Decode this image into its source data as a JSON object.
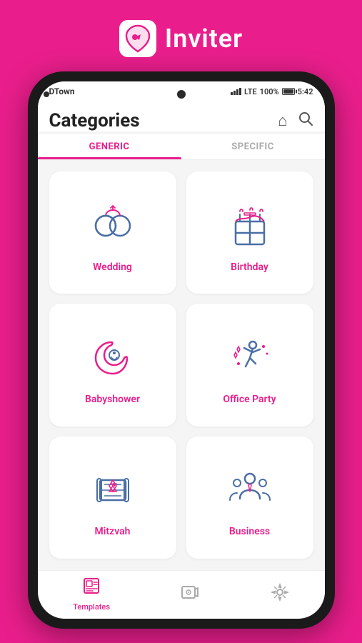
{
  "app": {
    "title": "Inviter",
    "logo_alt": "Inviter logo"
  },
  "status_bar": {
    "carrier": "DTown",
    "lte": "LTE",
    "battery": "100%",
    "time": "5:42"
  },
  "page": {
    "title": "Categories",
    "home_icon": "🏠",
    "search_icon": "🔍"
  },
  "tabs": [
    {
      "id": "generic",
      "label": "GENERIC",
      "active": true
    },
    {
      "id": "specific",
      "label": "SPECIFIC",
      "active": false
    }
  ],
  "categories": [
    {
      "id": "wedding",
      "label": "Wedding"
    },
    {
      "id": "birthday",
      "label": "Birthday"
    },
    {
      "id": "babyshower",
      "label": "Babyshower"
    },
    {
      "id": "office-party",
      "label": "Office Party"
    },
    {
      "id": "mitzvah",
      "label": "Mitzvah"
    },
    {
      "id": "business",
      "label": "Business"
    }
  ],
  "bottom_nav": [
    {
      "id": "templates",
      "label": "Templates",
      "active": true
    },
    {
      "id": "videos",
      "label": "",
      "active": false
    },
    {
      "id": "settings",
      "label": "",
      "active": false
    }
  ],
  "colors": {
    "primary": "#e91e8c",
    "inactive": "#aaaaaa",
    "icon_blue": "#4a6fa5",
    "icon_pink": "#e91e8c"
  }
}
